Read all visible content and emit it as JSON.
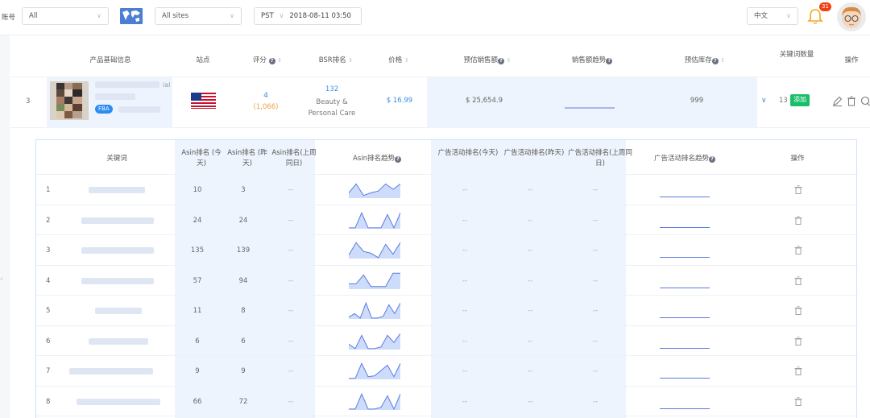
{
  "topbar": {
    "account_label": "账号",
    "account_select": "All",
    "site_select": "All sites",
    "timezone": "PST",
    "datetime": "2018-08-11 03:50",
    "language": "中文",
    "notification_count": "31"
  },
  "product_table": {
    "headers": {
      "product_info": "产品基础信息",
      "site": "站点",
      "rating": "评分",
      "bsr_rank": "BSR排名",
      "price": "价格",
      "est_sales": "预估销售额",
      "sales_trend": "销售额趋势",
      "est_stock": "预估库存",
      "keyword_count": "关键词数量",
      "actions": "操作"
    },
    "row": {
      "index": "3",
      "title_suffix": "ial",
      "fba_badge": "FBA",
      "rating": "4",
      "review_count": "(1,066)",
      "bsr_rank": "132",
      "bsr_category": "Beauty & Personal Care",
      "price": "$ 16.99",
      "est_sales": "$ 25,654.9",
      "est_stock": "999",
      "keyword_count": "13",
      "add_label": "添加"
    }
  },
  "keyword_table": {
    "headers": {
      "keyword": "关键词",
      "asin_today": "Asin排名 (今天)",
      "asin_yesterday": "Asin排名 (昨天)",
      "asin_last_week": "Asin排名(上周同日)",
      "asin_trend": "Asin排名趋势",
      "ad_today": "广告活动排名(今天)",
      "ad_yesterday": "广告活动排名(昨天)",
      "ad_last_week": "广告活动排名(上周同日)",
      "ad_trend": "广告活动排名趋势",
      "actions": "操作"
    },
    "rows": [
      {
        "index": "1",
        "today": "10",
        "yesterday": "3",
        "last_week": "--",
        "ad_today": "--",
        "ad_yesterday": "--",
        "ad_last_week": "--",
        "asin_trend": [
          6,
          16,
          3,
          6,
          8,
          16,
          10,
          16
        ]
      },
      {
        "index": "2",
        "today": "24",
        "yesterday": "24",
        "last_week": "--",
        "ad_today": "--",
        "ad_yesterday": "--",
        "ad_last_week": "--",
        "asin_trend": [
          1,
          1,
          18,
          1,
          1,
          1,
          16,
          1,
          18
        ]
      },
      {
        "index": "3",
        "today": "135",
        "yesterday": "139",
        "last_week": "--",
        "ad_today": "--",
        "ad_yesterday": "--",
        "ad_last_week": "--",
        "asin_trend": [
          4,
          18,
          8,
          6,
          1,
          16,
          5,
          18
        ]
      },
      {
        "index": "4",
        "today": "57",
        "yesterday": "94",
        "last_week": "--",
        "ad_today": "--",
        "ad_yesterday": "--",
        "ad_last_week": "--",
        "asin_trend": [
          6,
          6,
          16,
          3,
          3,
          3,
          18,
          18
        ]
      },
      {
        "index": "5",
        "today": "11",
        "yesterday": "8",
        "last_week": "--",
        "ad_today": "--",
        "ad_yesterday": "--",
        "ad_last_week": "--",
        "asin_trend": [
          2,
          6,
          1,
          18,
          1,
          1,
          3,
          16,
          6,
          18
        ]
      },
      {
        "index": "6",
        "today": "6",
        "yesterday": "6",
        "last_week": "--",
        "ad_today": "--",
        "ad_yesterday": "--",
        "ad_last_week": "--",
        "asin_trend": [
          6,
          1,
          16,
          1,
          1,
          3,
          16,
          8,
          18
        ]
      },
      {
        "index": "7",
        "today": "9",
        "yesterday": "9",
        "last_week": "--",
        "ad_today": "--",
        "ad_yesterday": "--",
        "ad_last_week": "--",
        "asin_trend": [
          1,
          1,
          18,
          3,
          4,
          10,
          16,
          3,
          18
        ]
      },
      {
        "index": "8",
        "today": "66",
        "yesterday": "72",
        "last_week": "--",
        "ad_today": "--",
        "ad_yesterday": "--",
        "ad_last_week": "--",
        "asin_trend": [
          1,
          1,
          18,
          1,
          1,
          3,
          16,
          1,
          18
        ]
      }
    ]
  },
  "colors": {
    "accent": "#3a8ee6",
    "green": "#19be6b",
    "badge_red": "#ed4014",
    "bell": "#f5a623",
    "spark_fill": "#cddcfa",
    "spark_line": "#5b7be0"
  }
}
